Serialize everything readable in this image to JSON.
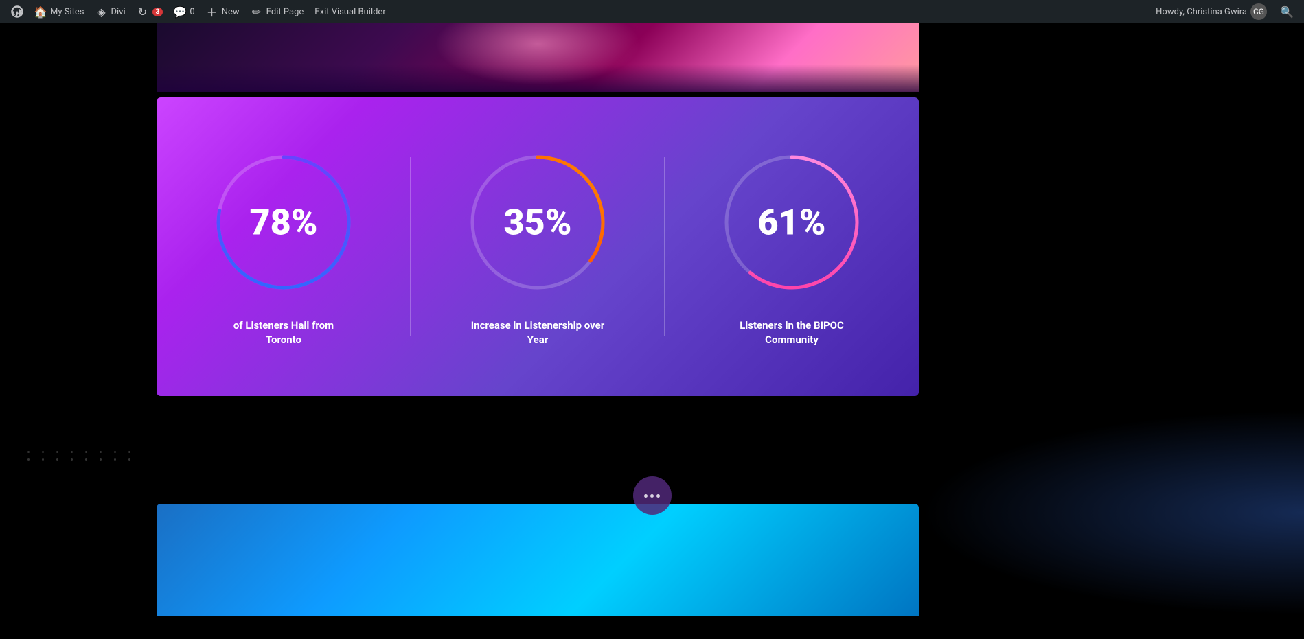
{
  "adminBar": {
    "wpIcon": "⊕",
    "mySites": "My Sites",
    "divi": "Divi",
    "updates": "3",
    "comments": "0",
    "new": "New",
    "editPage": "Edit Page",
    "exitBuilder": "Exit Visual Builder",
    "howdy": "Howdy, Christina Gwira",
    "searchIcon": "🔍"
  },
  "stats": [
    {
      "value": "78%",
      "percent": 78,
      "label": "of Listeners Hail from Toronto",
      "colorStart": "#3344dd",
      "colorEnd": "#6644ff",
      "gradientType": "blue"
    },
    {
      "value": "35%",
      "percent": 35,
      "label": "Increase in Listenership over Year",
      "colorStart": "#ff4400",
      "colorEnd": "#ff8800",
      "gradientType": "orange"
    },
    {
      "value": "61%",
      "percent": 61,
      "label": "Listeners in the BIPOC Community",
      "colorStart": "#ff44aa",
      "colorEnd": "#ff88cc",
      "gradientType": "pink"
    }
  ],
  "dotsIndicator": {
    "dots": 3
  }
}
